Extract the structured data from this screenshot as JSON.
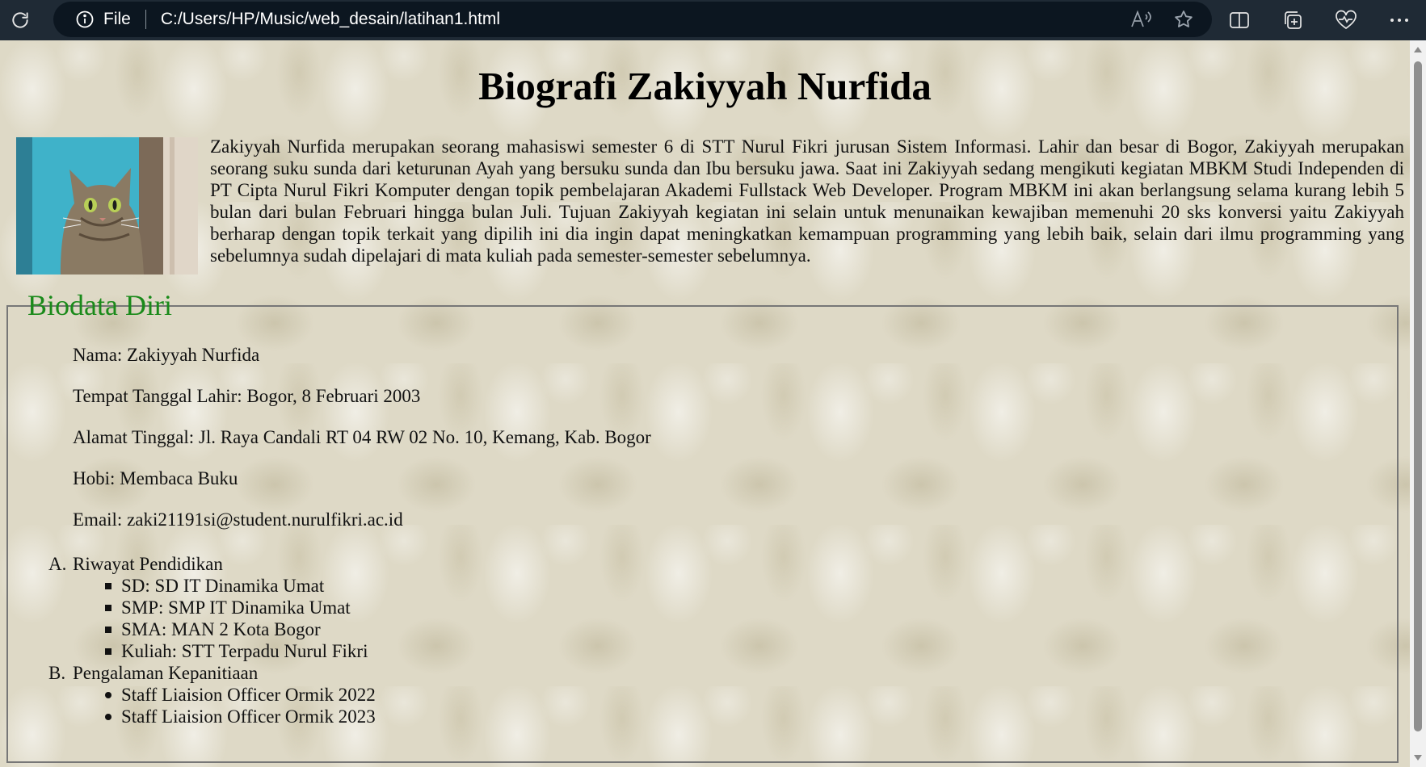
{
  "browser": {
    "file_label": "File",
    "url": "C:/Users/HP/Music/web_desain/latihan1.html"
  },
  "page": {
    "title": "Biografi Zakiyyah Nurfida",
    "paragraph": "Zakiyyah Nurfida merupakan seorang mahasiswi semester 6 di STT Nurul Fikri jurusan Sistem Informasi. Lahir dan besar di Bogor, Zakiyyah merupakan seorang suku sunda dari keturunan Ayah yang bersuku sunda dan Ibu bersuku jawa. Saat ini Zakiyyah sedang mengikuti kegiatan MBKM Studi Independen di PT Cipta Nurul Fikri Komputer dengan topik pembelajaran Akademi Fullstack Web Developer. Program MBKM ini akan berlangsung selama kurang lebih 5 bulan dari bulan Februari hingga bulan Juli. Tujuan Zakiyyah kegiatan ini selain untuk menunaikan kewajiban memenuhi 20 sks konversi yaitu Zakiyyah berharap dengan topik terkait yang dipilih ini dia ingin dapat meningkatkan kemampuan programming yang lebih baik, selain dari ilmu programming yang sebelumnya sudah dipelajari di mata kuliah pada semester-semester sebelumnya."
  },
  "biodata": {
    "legend": "Biodata Diri",
    "nama": "Nama: Zakiyyah Nurfida",
    "ttl": "Tempat Tanggal Lahir: Bogor, 8 Februari 2003",
    "alamat": "Alamat Tinggal: Jl. Raya Candali RT 04 RW 02 No. 10, Kemang, Kab. Bogor",
    "hobi": "Hobi: Membaca Buku",
    "email": "Email: zaki21191si@student.nurulfikri.ac.id"
  },
  "sections": {
    "pendidikan": {
      "marker": "A.",
      "title": "Riwayat Pendidikan",
      "items": [
        "SD: SD IT Dinamika Umat",
        "SMP: SMP IT Dinamika Umat",
        "SMA: MAN 2 Kota Bogor",
        "Kuliah: STT Terpadu Nurul Fikri"
      ]
    },
    "kepanitiaan": {
      "marker": "B.",
      "title": "Pengalaman Kepanitiaan",
      "items": [
        "Staff Liaision Officer Ormik 2022",
        "Staff Liaision Officer Ormik 2023"
      ]
    }
  },
  "colors": {
    "legend": "#1a8a1a",
    "chrome": "#1f2a35",
    "addressbar": "#0c1620"
  },
  "icons": [
    "reload-icon",
    "info-icon",
    "read-aloud-icon",
    "favorite-star-icon",
    "split-screen-icon",
    "collections-icon",
    "browser-essentials-icon",
    "more-menu-icon"
  ]
}
